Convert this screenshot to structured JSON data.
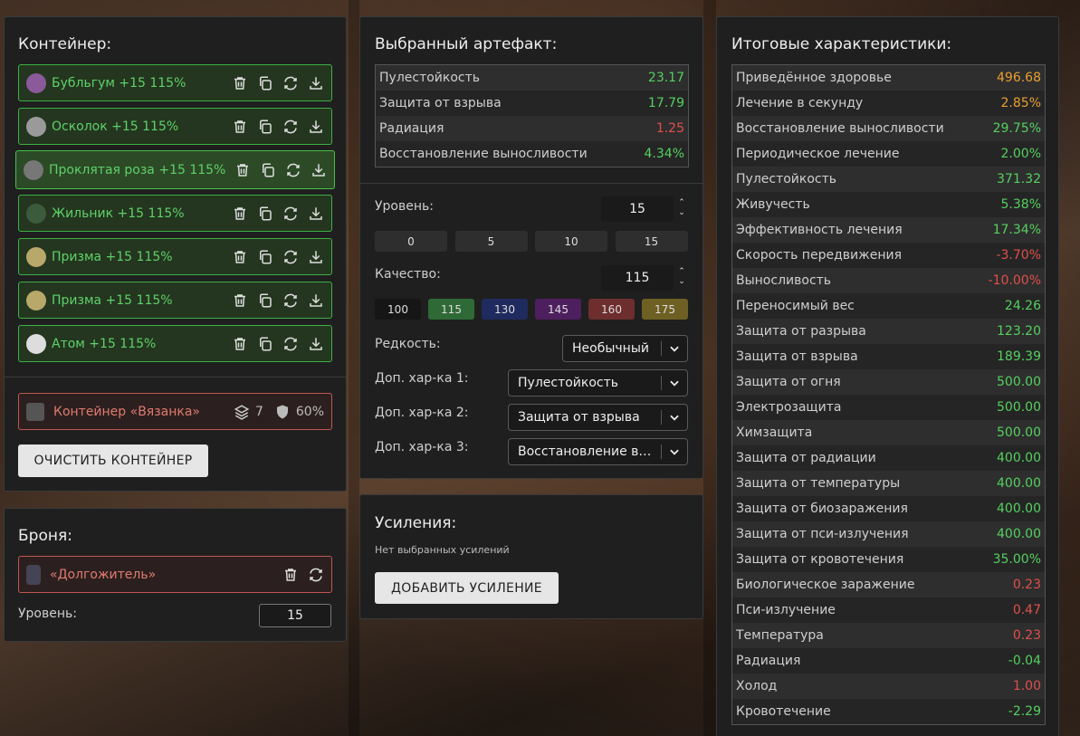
{
  "container_panel": {
    "title": "Контейнер:",
    "slots": [
      {
        "name": "Бубльгум +15 115%",
        "icon_color": "#8a5a9a",
        "icon": "bubblegum-icon"
      },
      {
        "name": "Осколок +15 115%",
        "icon_color": "#9a9a9a",
        "icon": "shard-icon"
      },
      {
        "name": "Проклятая роза +15 115%",
        "icon_color": "#777777",
        "icon": "rose-icon"
      },
      {
        "name": "Жильник +15 115%",
        "icon_color": "#3c5a3c",
        "icon": "vein-icon"
      },
      {
        "name": "Призма +15 115%",
        "icon_color": "#b8a86a",
        "icon": "prism-icon"
      },
      {
        "name": "Призма +15 115%",
        "icon_color": "#b8a86a",
        "icon": "prism-icon"
      },
      {
        "name": "Атом +15 115%",
        "icon_color": "#dddddd",
        "icon": "atom-icon"
      }
    ],
    "container": {
      "name": "Контейнер «Вязанка»",
      "capacity": "7",
      "protection": "60%"
    },
    "clear_button": "ОЧИСТИТЬ КОНТЕЙНЕР"
  },
  "armor_panel": {
    "title": "Броня:",
    "armor_name": "«Долгожитель»",
    "level_label": "Уровень:",
    "level_value": "15"
  },
  "artifact_panel": {
    "title": "Выбранный артефакт:",
    "stats": [
      {
        "label": "Пулестойкость",
        "value": "23.17",
        "color": "green"
      },
      {
        "label": "Защита от взрыва",
        "value": "17.79",
        "color": "green"
      },
      {
        "label": "Радиация",
        "value": "1.25",
        "color": "red"
      },
      {
        "label": "Восстановление выносливости",
        "value": "4.34%",
        "color": "green"
      }
    ],
    "level_label": "Уровень:",
    "level_value": "15",
    "level_presets": [
      "0",
      "5",
      "10",
      "15"
    ],
    "quality_label": "Качество:",
    "quality_value": "115",
    "quality_presets": [
      {
        "label": "100",
        "bg": "#161616"
      },
      {
        "label": "115",
        "bg": "#2f6a36"
      },
      {
        "label": "130",
        "bg": "#1f2a5e"
      },
      {
        "label": "145",
        "bg": "#4e1f5e"
      },
      {
        "label": "160",
        "bg": "#6e2e2e"
      },
      {
        "label": "175",
        "bg": "#6e6023"
      }
    ],
    "rarity_label": "Редкость:",
    "rarity_value": "Необычный",
    "extra1_label": "Доп. хар-ка 1:",
    "extra1_value": "Пулестойкость",
    "extra2_label": "Доп. хар-ка 2:",
    "extra2_value": "Защита от взрыва",
    "extra3_label": "Доп. хар-ка 3:",
    "extra3_value": "Восстановление выносливости"
  },
  "boost_panel": {
    "title": "Усиления:",
    "empty_text": "Нет выбранных усилений",
    "add_button": "ДОБАВИТЬ УСИЛЕНИЕ"
  },
  "totals_panel": {
    "title": "Итоговые характеристики:",
    "stats": [
      {
        "label": "Приведённое здоровье",
        "value": "496.68",
        "color": "orange"
      },
      {
        "label": "Лечение в секунду",
        "value": "2.85%",
        "color": "orange"
      },
      {
        "label": "Восстановление выносливости",
        "value": "29.75%",
        "color": "green"
      },
      {
        "label": "Периодическое лечение",
        "value": "2.00%",
        "color": "green"
      },
      {
        "label": "Пулестойкость",
        "value": "371.32",
        "color": "green"
      },
      {
        "label": "Живучесть",
        "value": "5.38%",
        "color": "green"
      },
      {
        "label": "Эффективность лечения",
        "value": "17.34%",
        "color": "green"
      },
      {
        "label": "Скорость передвижения",
        "value": "-3.70%",
        "color": "red"
      },
      {
        "label": "Выносливость",
        "value": "-10.00%",
        "color": "red"
      },
      {
        "label": "Переносимый вес",
        "value": "24.26",
        "color": "green"
      },
      {
        "label": "Защита от разрыва",
        "value": "123.20",
        "color": "green"
      },
      {
        "label": "Защита от взрыва",
        "value": "189.39",
        "color": "green"
      },
      {
        "label": "Защита от огня",
        "value": "500.00",
        "color": "green"
      },
      {
        "label": "Электрозащита",
        "value": "500.00",
        "color": "green"
      },
      {
        "label": "Химзащита",
        "value": "500.00",
        "color": "green"
      },
      {
        "label": "Защита от радиации",
        "value": "400.00",
        "color": "green"
      },
      {
        "label": "Защита от температуры",
        "value": "400.00",
        "color": "green"
      },
      {
        "label": "Защита от биозаражения",
        "value": "400.00",
        "color": "green"
      },
      {
        "label": "Защита от пси-излучения",
        "value": "400.00",
        "color": "green"
      },
      {
        "label": "Защита от кровотечения",
        "value": "35.00%",
        "color": "green"
      },
      {
        "label": "Биологическое заражение",
        "value": "0.23",
        "color": "red"
      },
      {
        "label": "Пси-излучение",
        "value": "0.47",
        "color": "red"
      },
      {
        "label": "Температура",
        "value": "0.23",
        "color": "red"
      },
      {
        "label": "Радиация",
        "value": "-0.04",
        "color": "green"
      },
      {
        "label": "Холод",
        "value": "1.00",
        "color": "red"
      },
      {
        "label": "Кровотечение",
        "value": "-2.29",
        "color": "green"
      }
    ]
  }
}
